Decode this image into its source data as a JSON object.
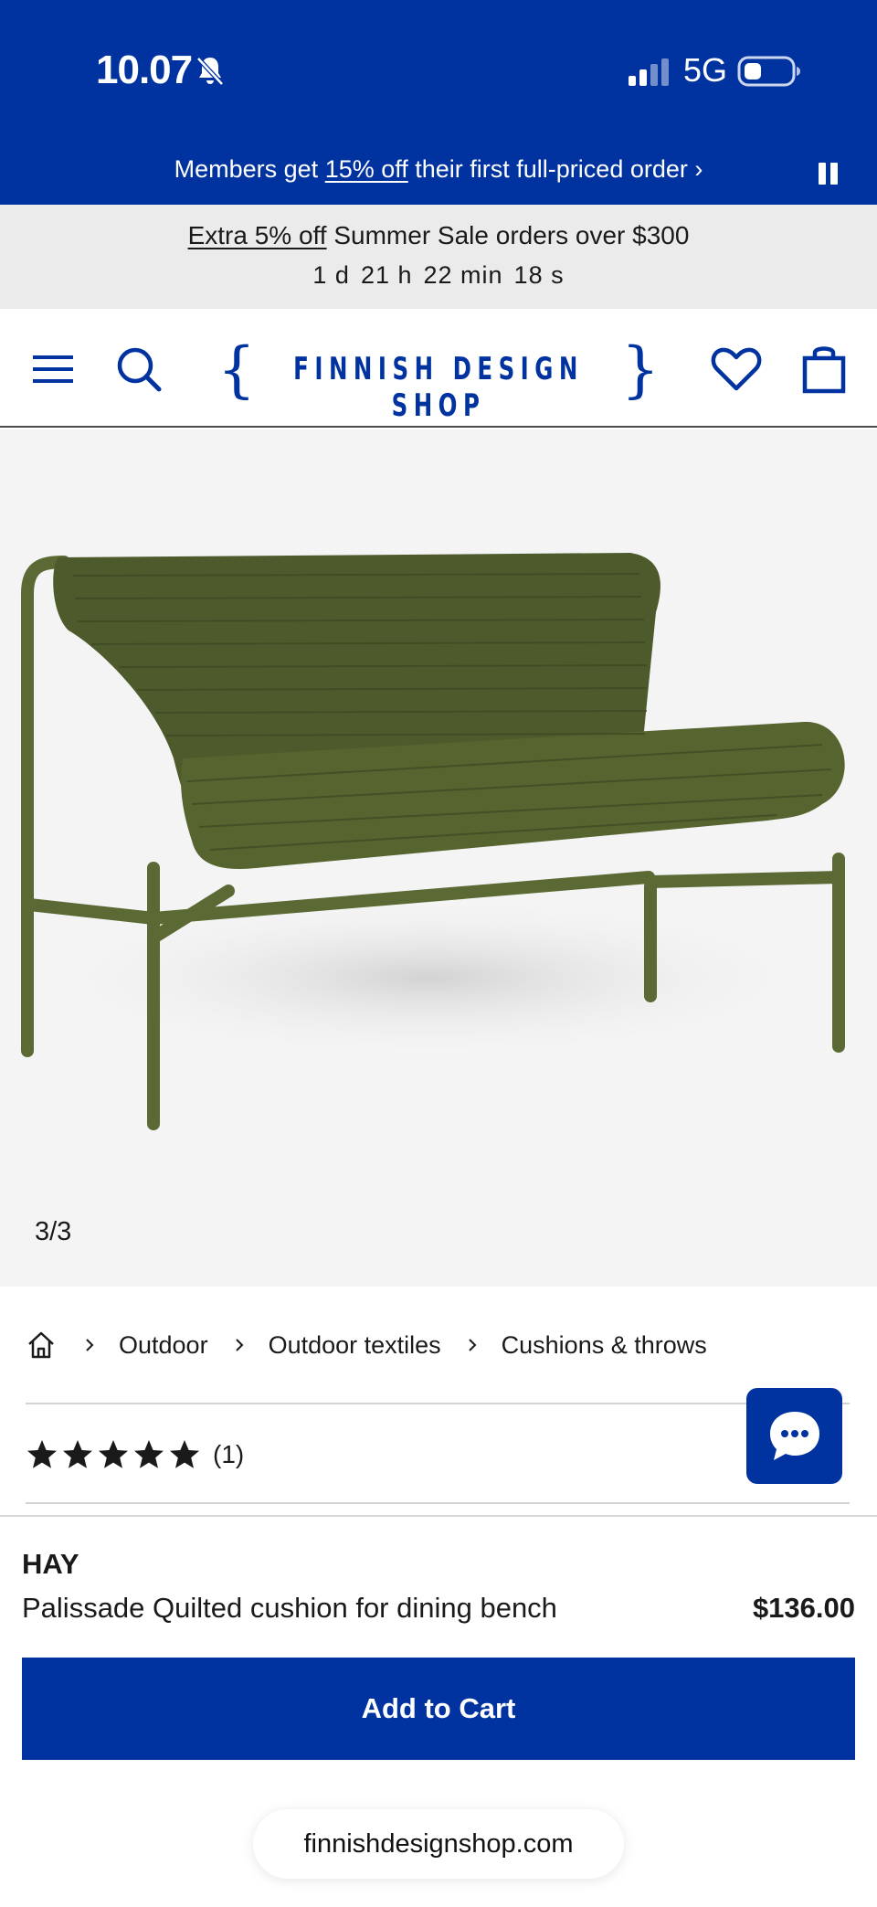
{
  "status_bar": {
    "time": "10.07",
    "network": "5G",
    "icons": [
      "bell-muted-icon",
      "signal-icon",
      "battery-icon"
    ]
  },
  "promo": {
    "prefix": "Members get ",
    "highlight": "15% off",
    "suffix": " their first full-priced order ›",
    "icon": "pause-icon"
  },
  "sale": {
    "highlight": "Extra 5% off",
    "text": " Summer Sale orders over $300",
    "countdown": {
      "days": "1 d",
      "hours": "21 h",
      "minutes": "22 min",
      "seconds": "18 s"
    }
  },
  "header": {
    "logo_text": "FINNISH DESIGN SHOP",
    "icons": [
      "menu-icon",
      "search-icon",
      "heart-icon",
      "bag-icon"
    ]
  },
  "gallery": {
    "counter": "3/3"
  },
  "breadcrumb": {
    "items": [
      "Outdoor",
      "Outdoor textiles",
      "Cushions & throws"
    ]
  },
  "rating": {
    "stars": 5,
    "max_stars": 5,
    "count": "(1)"
  },
  "product": {
    "brand": "HAY",
    "name": "Palissade Quilted cushion for dining bench",
    "price": "$136.00",
    "add_to_cart_label": "Add to Cart"
  },
  "browser": {
    "url": "finnishdesignshop.com"
  },
  "colors": {
    "brand_blue": "#0033a0",
    "sale_background": "#ebebeb",
    "image_background": "#f4f4f4",
    "product_green": "#4d5a2c"
  }
}
